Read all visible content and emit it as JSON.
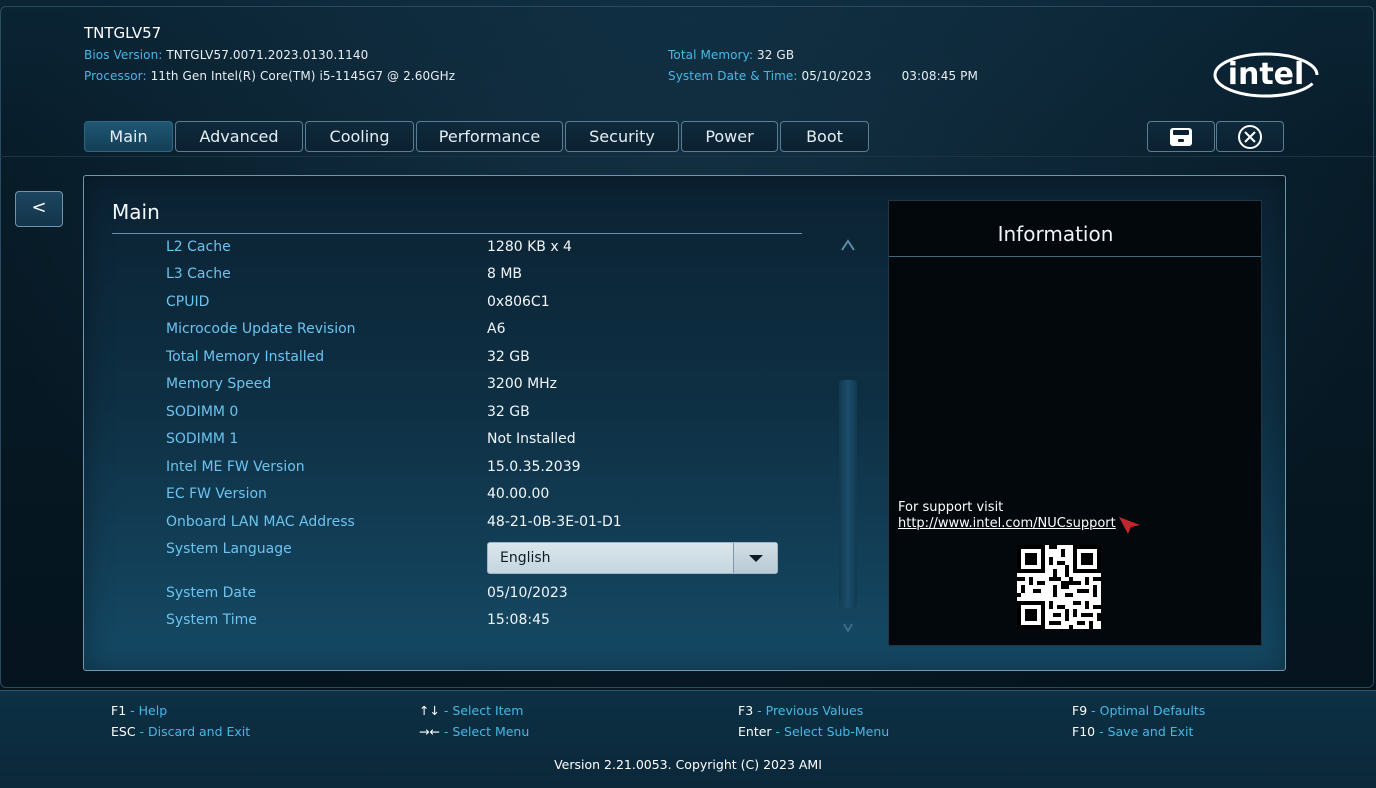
{
  "header": {
    "board_name": "TNTGLV57",
    "bios_label": "Bios Version:",
    "bios_value": "TNTGLV57.0071.2023.0130.1140",
    "processor_label": "Processor:",
    "processor_value": "11th Gen Intel(R) Core(TM) i5-1145G7 @ 2.60GHz",
    "memory_label": "Total Memory:",
    "memory_value": "32 GB",
    "datetime_label": "System Date & Time:",
    "date_value": "05/10/2023",
    "time_value": "03:08:45 PM",
    "logo_text": "intel"
  },
  "tabs": [
    {
      "label": "Main",
      "active": true
    },
    {
      "label": "Advanced"
    },
    {
      "label": "Cooling"
    },
    {
      "label": "Performance"
    },
    {
      "label": "Security"
    },
    {
      "label": "Power"
    },
    {
      "label": "Boot"
    }
  ],
  "toolbar": {
    "save_icon": "save-icon",
    "exit_icon": "close-circle-icon"
  },
  "nav": {
    "back_label": "<"
  },
  "main": {
    "title": "Main",
    "rows": [
      {
        "label": "L2 Cache",
        "value": "1280 KB x 4"
      },
      {
        "label": "L3 Cache",
        "value": "8 MB"
      },
      {
        "label": "CPUID",
        "value": "0x806C1"
      },
      {
        "label": "Microcode Update Revision",
        "value": "A6"
      },
      {
        "label": "Total Memory Installed",
        "value": "32 GB"
      },
      {
        "label": "Memory Speed",
        "value": "3200 MHz"
      },
      {
        "label": "SODIMM 0",
        "value": "32 GB"
      },
      {
        "label": "SODIMM 1",
        "value": "Not Installed"
      },
      {
        "label": "Intel ME FW Version",
        "value": "15.0.35.2039"
      },
      {
        "label": "EC FW Version",
        "value": "40.00.00"
      },
      {
        "label": "Onboard LAN MAC Address",
        "value": "48-21-0B-3E-01-D1"
      }
    ],
    "language": {
      "label": "System Language",
      "value": "English"
    },
    "date": {
      "label": "System Date",
      "value": "05/10/2023"
    },
    "time": {
      "label": "System Time",
      "value": "15:08:45"
    }
  },
  "information": {
    "title": "Information",
    "support_text": "For support visit",
    "support_link": "http://www.intel.com/NUCsupport"
  },
  "footer": {
    "items": [
      {
        "key": "F1",
        "desc": "Help"
      },
      {
        "key": "ESC",
        "desc": "Discard and Exit"
      },
      {
        "key": "↑↓",
        "desc": "Select Item"
      },
      {
        "key": "→←",
        "desc": "Select Menu"
      },
      {
        "key": "F3",
        "desc": "Previous Values"
      },
      {
        "key": "Enter",
        "desc": "Select Sub-Menu"
      },
      {
        "key": "F9",
        "desc": "Optimal Defaults"
      },
      {
        "key": "F10",
        "desc": "Save and Exit"
      }
    ],
    "separator": " - ",
    "version": "Version 2.21.0053. Copyright (C) 2023 AMI"
  },
  "colors": {
    "label_blue": "#46b8e6",
    "row_label": "#6cc3ef",
    "panel_border": "#6f97ad",
    "accent_red": "#c0262b"
  }
}
